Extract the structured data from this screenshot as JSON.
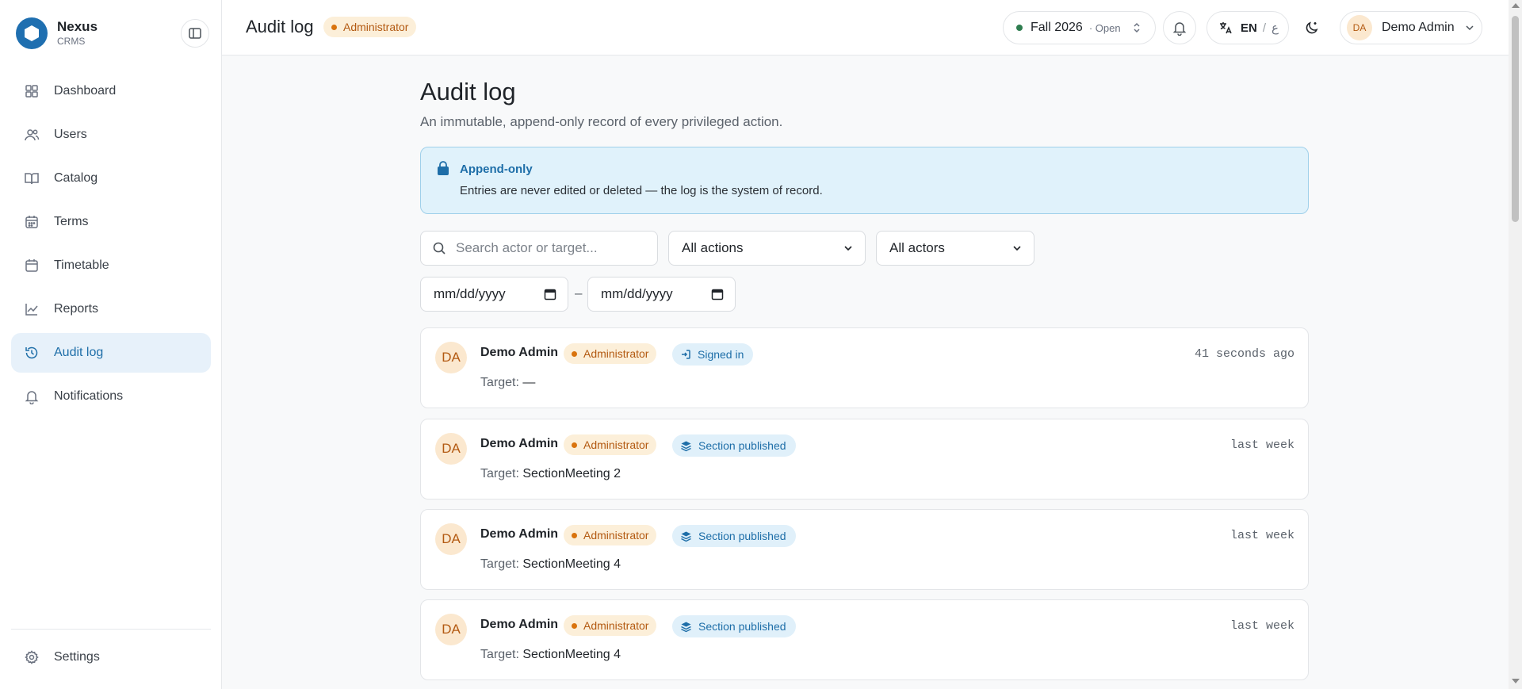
{
  "brand": {
    "name": "Nexus",
    "sub": "CRMS"
  },
  "sidebar": {
    "items": [
      {
        "label": "Dashboard",
        "icon": "grid-icon"
      },
      {
        "label": "Users",
        "icon": "users-icon"
      },
      {
        "label": "Catalog",
        "icon": "book-icon"
      },
      {
        "label": "Terms",
        "icon": "calendar-icon"
      },
      {
        "label": "Timetable",
        "icon": "calendar-icon"
      },
      {
        "label": "Reports",
        "icon": "chart-line-icon"
      },
      {
        "label": "Audit log",
        "icon": "history-icon",
        "active": true
      },
      {
        "label": "Notifications",
        "icon": "bell-icon"
      }
    ],
    "settings_label": "Settings"
  },
  "header": {
    "title": "Audit log",
    "role": "Administrator",
    "term": {
      "name": "Fall 2026",
      "status": "· Open"
    },
    "lang": {
      "en": "EN",
      "sep": "/",
      "ar": "ع"
    },
    "user": {
      "initials": "DA",
      "name": "Demo Admin"
    }
  },
  "main": {
    "title": "Audit log",
    "subtitle": "An immutable, append-only record of every privileged action.",
    "banner": {
      "title": "Append-only",
      "text": "Entries are never edited or deleted — the log is the system of record."
    },
    "filters": {
      "search_placeholder": "Search actor or target...",
      "actions_value": "All actions",
      "actors_value": "All actors",
      "date_placeholder": "mm/dd/yyyy",
      "date_separator": "–"
    },
    "entries": [
      {
        "initials": "DA",
        "actor": "Demo Admin",
        "role": "Administrator",
        "action": "Signed in",
        "action_icon": "sign-in-icon",
        "target_label": "Target:",
        "target": "—",
        "time": "41 seconds ago"
      },
      {
        "initials": "DA",
        "actor": "Demo Admin",
        "role": "Administrator",
        "action": "Section published",
        "action_icon": "layers-icon",
        "target_label": "Target:",
        "target": "SectionMeeting 2",
        "time": "last week"
      },
      {
        "initials": "DA",
        "actor": "Demo Admin",
        "role": "Administrator",
        "action": "Section published",
        "action_icon": "layers-icon",
        "target_label": "Target:",
        "target": "SectionMeeting 4",
        "time": "last week"
      },
      {
        "initials": "DA",
        "actor": "Demo Admin",
        "role": "Administrator",
        "action": "Section published",
        "action_icon": "layers-icon",
        "target_label": "Target:",
        "target": "SectionMeeting 4",
        "time": "last week"
      }
    ]
  },
  "colors": {
    "accent": "#1e6ea8",
    "role_badge_bg": "#fcefd9",
    "role_badge_text": "#b35a12",
    "banner_bg": "#e0f2fb",
    "active_nav_bg": "#e7f1fa"
  }
}
